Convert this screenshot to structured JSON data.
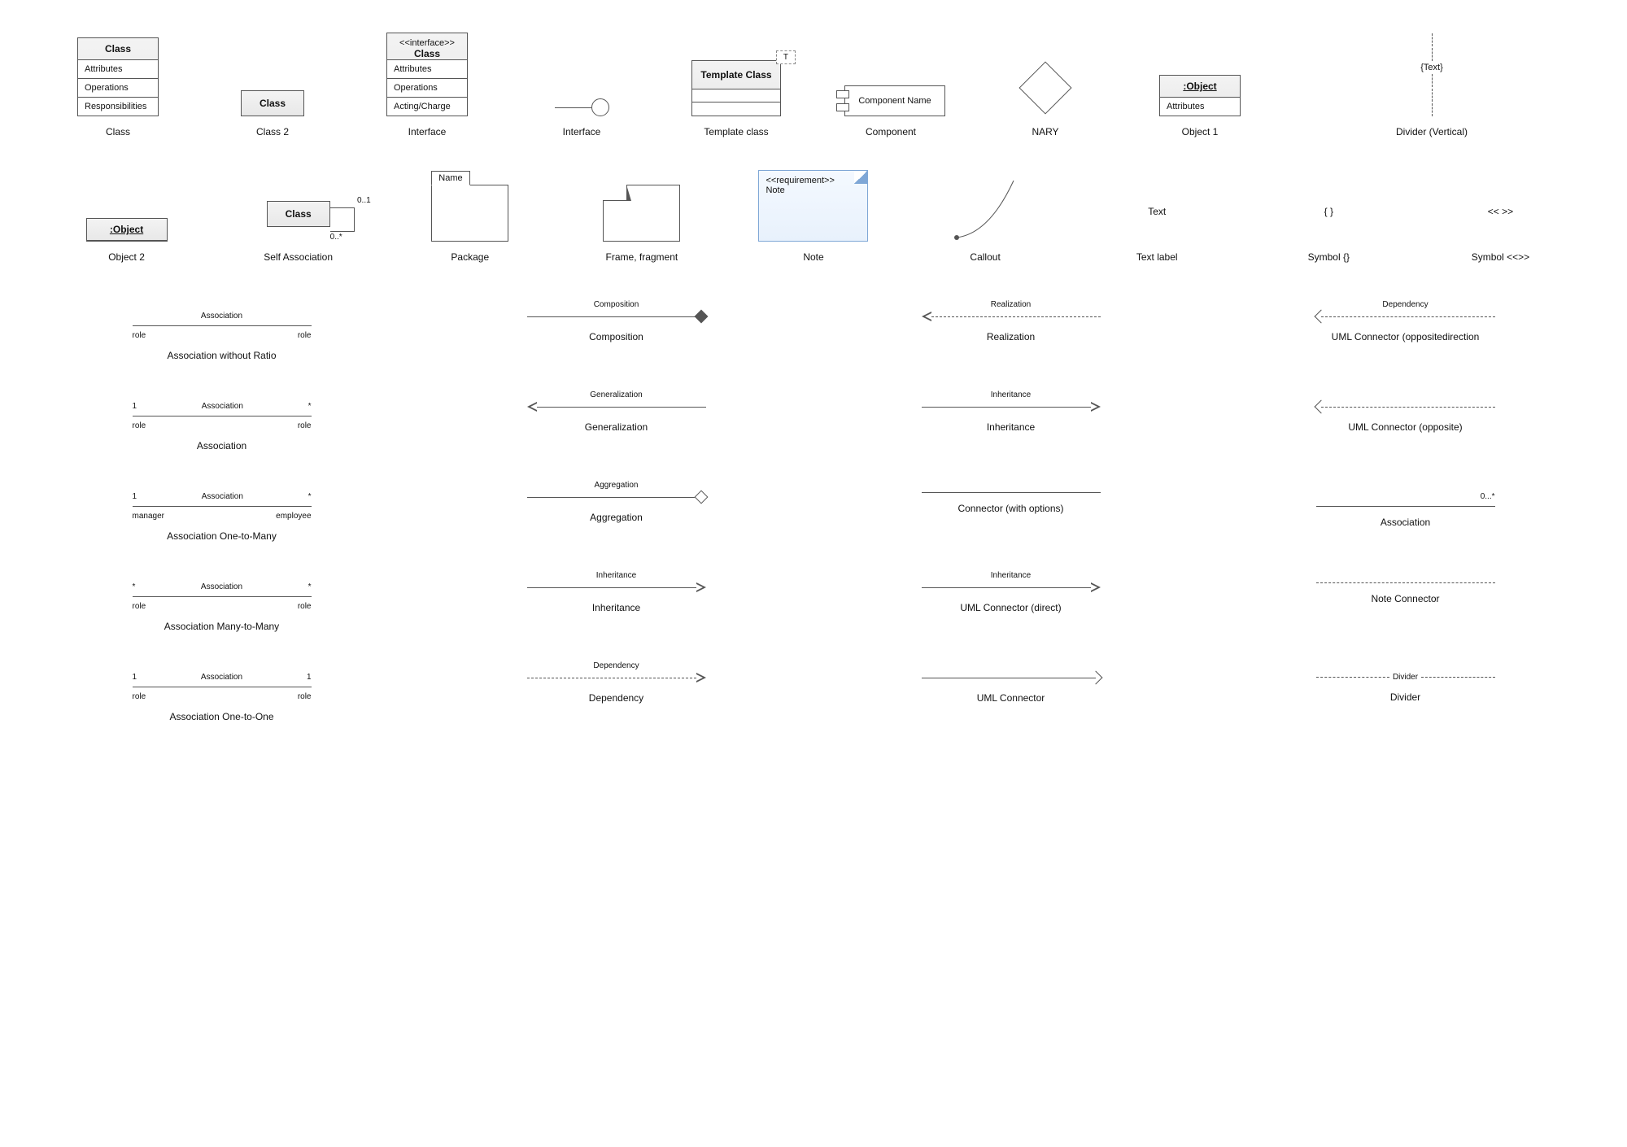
{
  "row1": {
    "class": {
      "title": "Class",
      "rows": [
        "Attributes",
        "Operations",
        "Responsibilities"
      ],
      "caption": "Class"
    },
    "class2": {
      "title": "Class",
      "caption": "Class 2"
    },
    "interface": {
      "stereo": "<<interface>>",
      "title": "Class",
      "rows": [
        "Attributes",
        "Operations",
        "Acting/Charge"
      ],
      "caption": "Interface"
    },
    "interface2": {
      "caption": "Interface"
    },
    "template": {
      "title": "Template Class",
      "param": "T",
      "caption": "Template class"
    },
    "component": {
      "name": "Component Name",
      "caption": "Component"
    },
    "nary": {
      "caption": "NARY"
    },
    "object1": {
      "title": ":Object",
      "rows": [
        "Attributes"
      ],
      "caption": "Object 1"
    },
    "dividerv": {
      "text": "{Text}",
      "caption": "Divider (Vertical)"
    }
  },
  "row2": {
    "object2": {
      "title": ":Object",
      "caption": "Object 2"
    },
    "selfassoc": {
      "title": "Class",
      "mult1": "0..1",
      "mult2": "0..*",
      "caption": "Self Association"
    },
    "package": {
      "tab": "Name",
      "caption": "Package"
    },
    "frame": {
      "caption": "Frame, fragment"
    },
    "note": {
      "stereo": "<<requirement>>",
      "text": "Note",
      "caption": "Note"
    },
    "callout": {
      "caption": "Callout"
    },
    "textlabel": {
      "text": "Text",
      "caption": "Text label"
    },
    "symbolbr": {
      "text": "{ }",
      "caption": "Symbol {}"
    },
    "symbolang": {
      "text": "<<  >>",
      "caption": "Symbol <<>>"
    }
  },
  "connectors": [
    [
      {
        "type": "assoc",
        "top_l": "",
        "top_m": "Association",
        "top_r": "",
        "bot_l": "role",
        "bot_r": "role",
        "caption": "Association without Ratio"
      },
      {
        "type": "line-diamond-filled",
        "label": "Composition",
        "caption": "Composition"
      },
      {
        "type": "dash-open-l",
        "label": "Realization",
        "caption": "Realization"
      },
      {
        "type": "dash-thin-l",
        "label": "Dependency",
        "caption": "UML Connector (oppositedirection"
      }
    ],
    [
      {
        "type": "assoc",
        "top_l": "1",
        "top_m": "Association",
        "top_r": "*",
        "bot_l": "role",
        "bot_r": "role",
        "caption": "Association"
      },
      {
        "type": "line-open-l",
        "label": "Generalization",
        "caption": "Generalization"
      },
      {
        "type": "line-open-r",
        "label": "Inheritance",
        "caption": "Inheritance"
      },
      {
        "type": "dash-thin-l",
        "label": "",
        "caption": "UML Connector (opposite)"
      }
    ],
    [
      {
        "type": "assoc",
        "top_l": "1",
        "top_m": "Association",
        "top_r": "*",
        "bot_l": "manager",
        "bot_r": "employee",
        "caption": "Association One-to-Many"
      },
      {
        "type": "line-diamond-open",
        "label": "Aggregation",
        "caption": "Aggregation"
      },
      {
        "type": "line-plain",
        "label": "",
        "caption": "Connector (with options)"
      },
      {
        "type": "line-mult",
        "mult": "0...*",
        "caption": "Association"
      }
    ],
    [
      {
        "type": "assoc",
        "top_l": "*",
        "top_m": "Association",
        "top_r": "*",
        "bot_l": "role",
        "bot_r": "role",
        "caption": "Association Many-to-Many"
      },
      {
        "type": "line-open-r",
        "label": "Inheritance",
        "caption": "Inheritance"
      },
      {
        "type": "line-open-r",
        "label": "Inheritance",
        "caption": "UML Connector (direct)"
      },
      {
        "type": "dash-plain",
        "label": "",
        "caption": "Note Connector"
      }
    ],
    [
      {
        "type": "assoc",
        "top_l": "1",
        "top_m": "Association",
        "top_r": "1",
        "bot_l": "role",
        "bot_r": "role",
        "caption": "Association One-to-One"
      },
      {
        "type": "dash-open-r",
        "label": "Dependency",
        "caption": "Dependency"
      },
      {
        "type": "line-thin-r",
        "label": "",
        "caption": "UML Connector"
      },
      {
        "type": "dash-label",
        "label": "Divider",
        "caption": "Divider"
      }
    ]
  ]
}
